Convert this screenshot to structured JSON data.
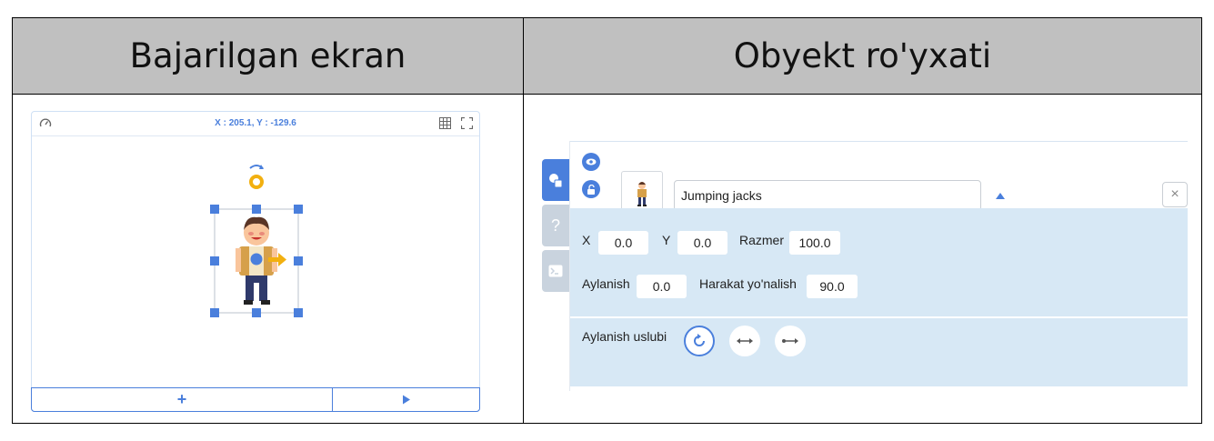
{
  "table": {
    "left_header": "Bajarilgan ekran",
    "right_header": "Obyekt ro'yxati"
  },
  "stage": {
    "coords": "X : 205.1, Y : -129.6",
    "speed_icon": "speedometer-icon",
    "grid_icon": "grid-icon",
    "fullscreen_icon": "fullscreen-icon",
    "add_label": "+",
    "play_icon": "play-icon",
    "accent_color": "#4a7fdc"
  },
  "object_panel": {
    "object_name": "Jumping jacks",
    "close_label": "×",
    "fields": {
      "x_label": "X",
      "x_value": "0.0",
      "y_label": "Y",
      "y_value": "0.0",
      "size_label": "Razmer",
      "size_value": "100.0",
      "rotation_label": "Aylanish",
      "rotation_value": "0.0",
      "direction_label": "Harakat yo'nalish",
      "direction_value": "90.0",
      "rotation_style_label": "Aylanish uslubi"
    },
    "tabs": [
      "object-tab",
      "help-tab",
      "console-tab"
    ],
    "help_glyph": "?",
    "panel_bg_color": "#d7e8f5"
  }
}
